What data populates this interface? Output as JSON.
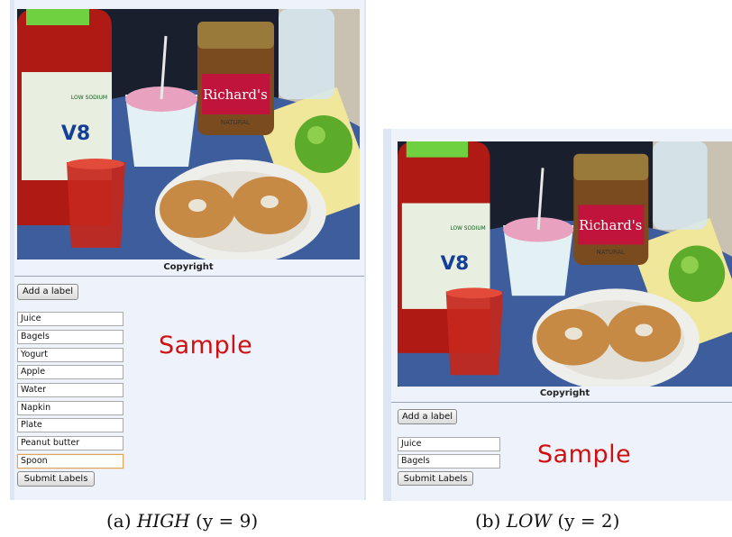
{
  "panels": [
    {
      "id": "high",
      "copyright": "Copyright",
      "add_label_button": "Add a label",
      "labels": [
        "Juice",
        "Bagels",
        "Yogurt",
        "Apple",
        "Water",
        "Napkin",
        "Plate",
        "Peanut butter",
        "Spoon"
      ],
      "focused_index": 8,
      "submit_button": "Submit Labels",
      "watermark": "Sample",
      "caption_prefix": "(a) ",
      "caption_level": "HIGH",
      "caption_suffix": " (y = 9)"
    },
    {
      "id": "low",
      "copyright": "Copyright",
      "add_label_button": "Add a label",
      "labels": [
        "Juice",
        "Bagels"
      ],
      "focused_index": -1,
      "submit_button": "Submit Labels",
      "watermark": "Sample",
      "caption_prefix": "(b) ",
      "caption_level": "LOW",
      "caption_suffix": " (y = 2)"
    }
  ],
  "photo": {
    "jar_label_text": "Richard's",
    "jar_sub_text": "NATURAL",
    "v8_text": "V8",
    "v8_tag": "LOW SODIUM"
  },
  "colors": {
    "panel_bg": "#dde6f4",
    "watermark": "#d01010",
    "focus_border": "#e2a65a"
  }
}
